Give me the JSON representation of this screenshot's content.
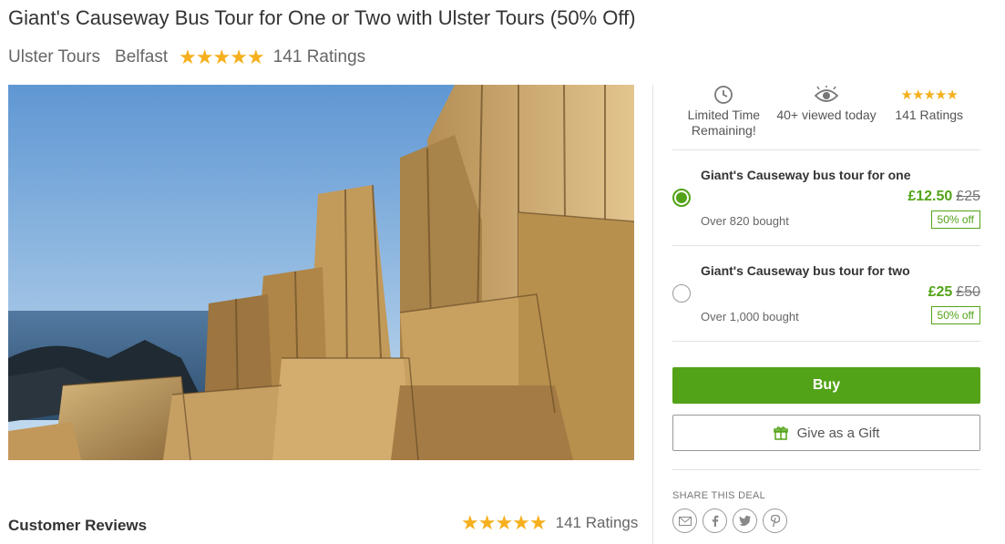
{
  "deal": {
    "title": "Giant's Causeway Bus Tour for One or Two with Ulster Tours (50% Off)",
    "merchant": "Ulster Tours",
    "location": "Belfast",
    "stars": "★★★★★",
    "ratings_label": "141 Ratings"
  },
  "hero_image": {
    "icon": "coastal-basalt-columns-photo"
  },
  "stats": {
    "limited_time": "Limited Time Remaining!",
    "viewed": "40+ viewed today",
    "ratings_stars": "★★★★★",
    "ratings": "141 Ratings"
  },
  "options": [
    {
      "name": "Giant's Causeway bus tour for one",
      "price": "£12.50",
      "old_price": "£25",
      "bought": "Over 820 bought",
      "discount": "50% off",
      "selected": true
    },
    {
      "name": "Giant's Causeway bus tour for two",
      "price": "£25",
      "old_price": "£50",
      "bought": "Over 1,000 bought",
      "discount": "50% off",
      "selected": false
    }
  ],
  "actions": {
    "buy": "Buy",
    "gift": "Give as a Gift"
  },
  "share": {
    "label": "SHARE THIS DEAL",
    "icons": [
      "email-icon",
      "facebook-icon",
      "twitter-icon",
      "pinterest-icon"
    ]
  },
  "reviews": {
    "title": "Customer Reviews",
    "stars": "★★★★★",
    "ratings": "141 Ratings"
  },
  "colors": {
    "accent": "#53a318",
    "star": "#f6b01e"
  }
}
